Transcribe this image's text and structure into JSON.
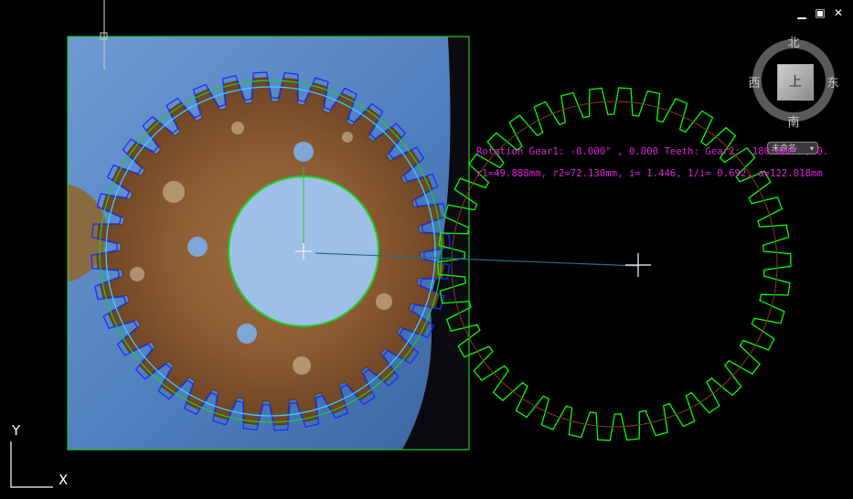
{
  "window_controls": {
    "minimize": "▁",
    "maximize": "▣",
    "close": "✕"
  },
  "viewcube": {
    "north": "北",
    "south": "南",
    "west": "西",
    "east": "东",
    "face": "上"
  },
  "ucs_dropdown": {
    "value": "未命名"
  },
  "annotation": {
    "line1": "Rotation Gear1: -0.000° ,  0.000 Teeth:  Gear2: -180.000° ,  0.",
    "line2": "r1=49.888mm, r2=72.130mm, i= 1.446, 1/i= 0.692, a=122.018mm"
  },
  "axis": {
    "y": "Y",
    "x": "X"
  },
  "gear1": {
    "teeth": 36
  },
  "gear2": {
    "teeth": 38
  },
  "colors": {
    "background": "#000000",
    "gear_outline": "#00ff00",
    "gear1_profile_blue": "#1a2cff",
    "gear1_profile_cyan": "#3ad0ff",
    "pitch_circle_green": "#22cc22",
    "annotation_magenta": "#e020e0",
    "rust": "#8a5a32",
    "photo_blue": "#5a88c4"
  }
}
